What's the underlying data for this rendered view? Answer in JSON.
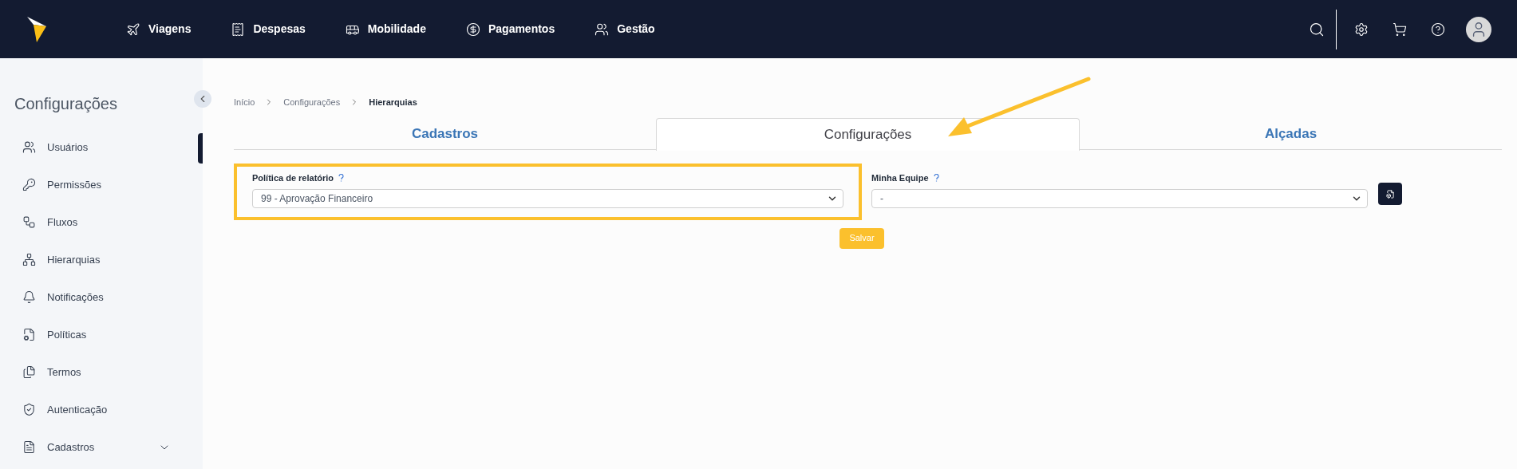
{
  "top_nav": {
    "items": [
      {
        "kind": "plane",
        "label": "Viagens"
      },
      {
        "kind": "receipt",
        "label": "Despesas"
      },
      {
        "kind": "bus",
        "label": "Mobilidade"
      },
      {
        "kind": "dollar",
        "label": "Pagamentos"
      },
      {
        "kind": "users",
        "label": "Gestão"
      }
    ]
  },
  "sidebar": {
    "title": "Configurações",
    "items": [
      {
        "kind": "users",
        "label": "Usuários"
      },
      {
        "kind": "key",
        "label": "Permissões"
      },
      {
        "kind": "flow",
        "label": "Fluxos"
      },
      {
        "kind": "tree",
        "label": "Hierarquias"
      },
      {
        "kind": "bell",
        "label": "Notificações"
      },
      {
        "kind": "policy",
        "label": "Políticas"
      },
      {
        "kind": "doc",
        "label": "Termos"
      },
      {
        "kind": "shield",
        "label": "Autenticação"
      },
      {
        "kind": "form",
        "label": "Cadastros",
        "expanded": false
      }
    ]
  },
  "breadcrumb": [
    "Início",
    "Configurações",
    "Hierarquias"
  ],
  "tabs": [
    {
      "label": "Cadastros",
      "selected": false
    },
    {
      "label": "Configurações",
      "selected": true
    },
    {
      "label": "Alçadas",
      "selected": false
    }
  ],
  "form": {
    "fields": [
      {
        "label": "Política de relatório",
        "value": "99 - Aprovação Financeiro",
        "highlighted": true
      },
      {
        "label": "Minha Equipe",
        "value": "-",
        "highlighted": false
      }
    ],
    "save_button": "Salvar"
  }
}
